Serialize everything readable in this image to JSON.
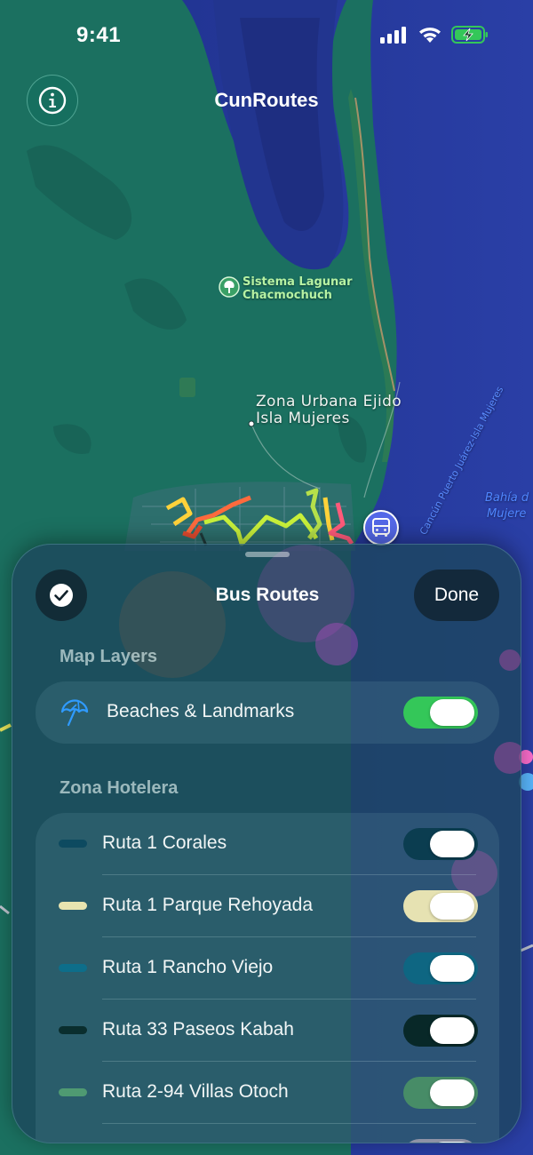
{
  "status_bar": {
    "time": "9:41"
  },
  "header": {
    "title": "CunRoutes"
  },
  "map": {
    "poi": "Sistema Lagunar\nChacmochuch",
    "place_line1": "Zona Urbana Ejido",
    "place_line2": "Isla Mujeres",
    "road_label": "Cancún Puerto Juárez-Isla Mujeres",
    "water_label_line1": "Bahía d",
    "water_label_line2": "Mujere",
    "route_colors": [
      "#ff6a3d",
      "#ffd23a",
      "#c8f03a",
      "#ff5a7a",
      "#b6e04a",
      "#e04a2e"
    ]
  },
  "sheet": {
    "title": "Bus Routes",
    "done_label": "Done",
    "map_layers_header": "Map Layers",
    "layer": {
      "label": "Beaches & Landmarks",
      "icon": "beach-umbrella-icon",
      "enabled": true,
      "color": "#34c759"
    },
    "zona_header": "Zona Hotelera",
    "routes": [
      {
        "label": "Ruta 1 Corales",
        "color": "#0d4a60",
        "track": "#0b3d50",
        "enabled": true
      },
      {
        "label": "Ruta 1 Parque Rehoyada",
        "color": "#e8e4b0",
        "track": "#e6e2b2",
        "enabled": true
      },
      {
        "label": "Ruta 1 Rancho Viejo",
        "color": "#0d6e8a",
        "track": "#0e6682",
        "enabled": true
      },
      {
        "label": "Ruta 33 Paseos Kabah",
        "color": "#0a2e2e",
        "track": "#082828",
        "enabled": true
      },
      {
        "label": "Ruta 2-94 Villas Otoch",
        "color": "#4f9a72",
        "track": "#478c67",
        "enabled": true
      },
      {
        "label": "",
        "color": "#8a8fa0",
        "track": "#8f93a6",
        "enabled": true
      }
    ]
  }
}
